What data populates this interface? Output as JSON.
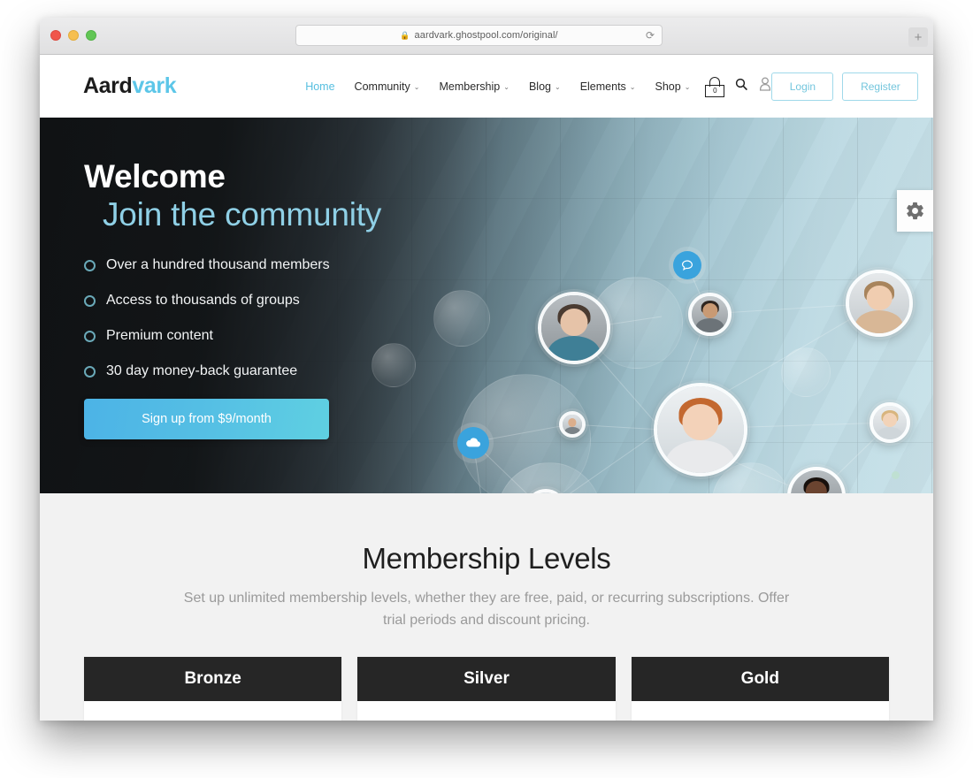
{
  "browser": {
    "url": "aardvark.ghostpool.com/original/",
    "lock_icon": "lock-icon",
    "reload_icon": "reload-icon",
    "newtab_label": "+",
    "traffic_lights": [
      "close",
      "minimize",
      "maximize"
    ]
  },
  "header": {
    "logo": {
      "part1": "Aard",
      "part2": "vark"
    },
    "nav": [
      {
        "label": "Home",
        "has_caret": false,
        "active": true
      },
      {
        "label": "Community",
        "has_caret": true,
        "active": false
      },
      {
        "label": "Membership",
        "has_caret": true,
        "active": false
      },
      {
        "label": "Blog",
        "has_caret": true,
        "active": false
      },
      {
        "label": "Elements",
        "has_caret": true,
        "active": false
      },
      {
        "label": "Shop",
        "has_caret": true,
        "active": false
      }
    ],
    "caret_glyph": "⌄",
    "cart": {
      "icon": "shopping-bag-icon",
      "count": "0"
    },
    "search_icon": "search-icon",
    "account_icon": "user-icon",
    "login_label": "Login",
    "register_label": "Register"
  },
  "hero": {
    "heading_line1": "Welcome",
    "heading_line2": "Join the community",
    "features": [
      "Over a hundred thousand members",
      "Access to thousands of groups",
      "Premium content",
      "30 day money-back guarantee"
    ],
    "cta_label": "Sign up from $9/month",
    "floating_icons": [
      "chat-bubble-icon",
      "cloud-icon"
    ],
    "chat_glyph": "●",
    "settings_tab_icon": "gear-icon"
  },
  "levels": {
    "title": "Membership Levels",
    "subtitle": "Set up unlimited membership levels, whether they are free, paid, or recurring subscriptions. Offer trial periods and discount pricing.",
    "cards": [
      {
        "name": "Bronze",
        "price": "$"
      },
      {
        "name": "Silver",
        "price": "$"
      },
      {
        "name": "Gold",
        "price": "$"
      }
    ]
  },
  "colors": {
    "accent_blue": "#57bfe0",
    "logo_blue": "#5cc6e8",
    "hero_sub_blue": "#8fd0e6",
    "card_header_dark": "#262626",
    "section_bg": "#f2f2f2"
  }
}
